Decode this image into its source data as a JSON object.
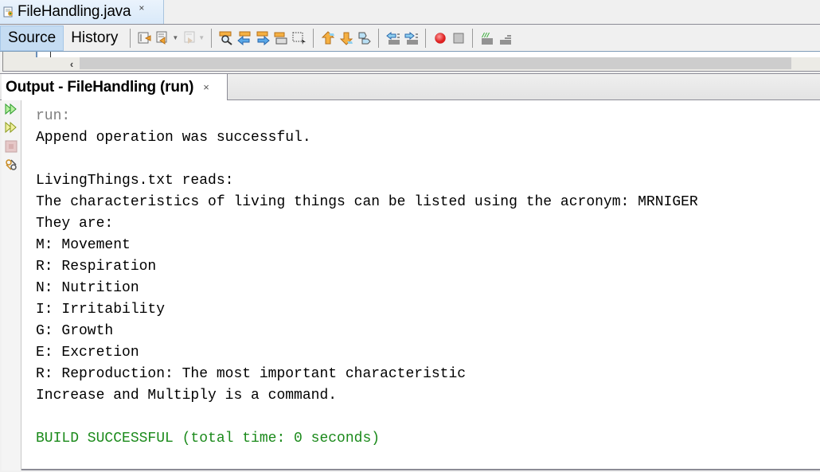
{
  "editor": {
    "file_tab": {
      "label": "FileHandling.java",
      "close": "×",
      "icon": "java-file-icon",
      "active": true
    },
    "toolbar": {
      "views": [
        {
          "label": "Source",
          "active": true
        },
        {
          "label": "History",
          "active": false
        }
      ],
      "icons": [
        {
          "name": "last-edit-icon",
          "enabled": true
        },
        {
          "name": "back-icon",
          "enabled": true,
          "dropdown": true
        },
        {
          "name": "forward-icon",
          "enabled": false,
          "dropdown": true
        },
        {
          "name": "find-selection-icon",
          "enabled": true
        },
        {
          "name": "find-previous-icon",
          "enabled": true
        },
        {
          "name": "find-next-icon",
          "enabled": true
        },
        {
          "name": "toggle-highlight-icon",
          "enabled": true
        },
        {
          "name": "toggle-rectangular-selection-icon",
          "enabled": true
        },
        {
          "name": "previous-bookmark-icon",
          "enabled": true
        },
        {
          "name": "next-bookmark-icon",
          "enabled": true
        },
        {
          "name": "toggle-bookmark-icon",
          "enabled": true
        },
        {
          "name": "shift-line-left-icon",
          "enabled": true
        },
        {
          "name": "shift-line-right-icon",
          "enabled": true
        },
        {
          "name": "start-macro-recording-icon",
          "enabled": true
        },
        {
          "name": "stop-macro-recording-icon",
          "enabled": true
        },
        {
          "name": "comment-icon",
          "enabled": true
        },
        {
          "name": "uncomment-icon",
          "enabled": true
        }
      ]
    },
    "scroll_left": "‹"
  },
  "output": {
    "tab": {
      "label": "Output - FileHandling (run)",
      "close": "×"
    },
    "side_buttons": [
      {
        "name": "rerun-icon",
        "enabled": true
      },
      {
        "name": "rerun-with-params-icon",
        "enabled": true
      },
      {
        "name": "stop-icon",
        "enabled": false
      },
      {
        "name": "settings-icon",
        "enabled": true
      }
    ],
    "lines": [
      {
        "text": "run:",
        "kind": "run"
      },
      {
        "text": "Append operation was successful.",
        "kind": "normal"
      },
      {
        "text": "",
        "kind": "normal"
      },
      {
        "text": "LivingThings.txt reads:",
        "kind": "normal"
      },
      {
        "text": "The characteristics of living things can be listed using the acronym: MRNIGER",
        "kind": "normal"
      },
      {
        "text": "They are:",
        "kind": "normal"
      },
      {
        "text": "M: Movement",
        "kind": "normal"
      },
      {
        "text": "R: Respiration",
        "kind": "normal"
      },
      {
        "text": "N: Nutrition",
        "kind": "normal"
      },
      {
        "text": "I: Irritability",
        "kind": "normal"
      },
      {
        "text": "G: Growth",
        "kind": "normal"
      },
      {
        "text": "E: Excretion",
        "kind": "normal"
      },
      {
        "text": "R: Reproduction: The most important characteristic",
        "kind": "normal"
      },
      {
        "text": "Increase and Multiply is a command.",
        "kind": "normal"
      },
      {
        "text": "",
        "kind": "normal"
      },
      {
        "text": "BUILD SUCCESSFUL (total time: 0 seconds)",
        "kind": "build"
      }
    ]
  },
  "colors": {
    "build_success": "#1b8a1b",
    "run_label": "#808080",
    "active_view": "#c5dcf2"
  }
}
